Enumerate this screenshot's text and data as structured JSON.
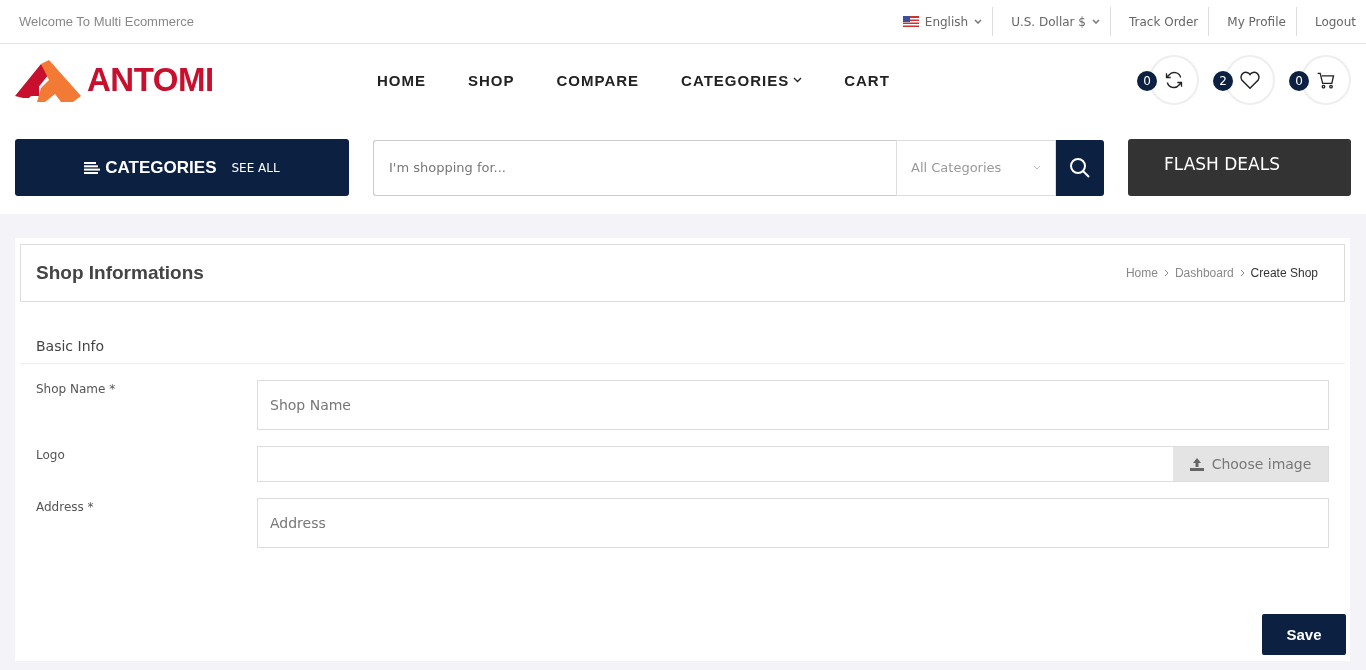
{
  "top_bar": {
    "welcome": "Welcome To Multi Ecommerce",
    "language": "English",
    "currency": "U.S. Dollar $",
    "links": [
      "Track Order",
      "My Profile",
      "Logout"
    ]
  },
  "header": {
    "logo": "ANTOMI",
    "nav": [
      {
        "label": "HOME",
        "dropdown": false
      },
      {
        "label": "SHOP",
        "dropdown": false
      },
      {
        "label": "COMPARE",
        "dropdown": false
      },
      {
        "label": "CATEGORIES",
        "dropdown": true
      },
      {
        "label": "CART",
        "dropdown": false
      }
    ],
    "counters": [
      {
        "kind": "compare",
        "count": "0"
      },
      {
        "kind": "wishlist",
        "count": "2"
      },
      {
        "kind": "cart",
        "count": "0"
      }
    ]
  },
  "search_row": {
    "categories_button": "CATEGORIES",
    "see_all": "SEE ALL",
    "search": {
      "placeholder": "I'm shopping for..."
    },
    "category_select": "All Categories",
    "flash_deals": "FLASH DEALS"
  },
  "page": {
    "title": "Shop Informations",
    "breadcrumb": [
      {
        "label": "Home",
        "current": false
      },
      {
        "label": "Dashboard",
        "current": false
      },
      {
        "label": "Create Shop",
        "current": true
      }
    ],
    "section": "Basic Info",
    "fields": [
      {
        "kind": "text",
        "label": "Shop Name *",
        "placeholder": "Shop Name"
      },
      {
        "kind": "file",
        "label": "Logo",
        "button": "Choose image"
      },
      {
        "kind": "text",
        "label": "Address *",
        "placeholder": "Address"
      }
    ],
    "save": "Save"
  }
}
